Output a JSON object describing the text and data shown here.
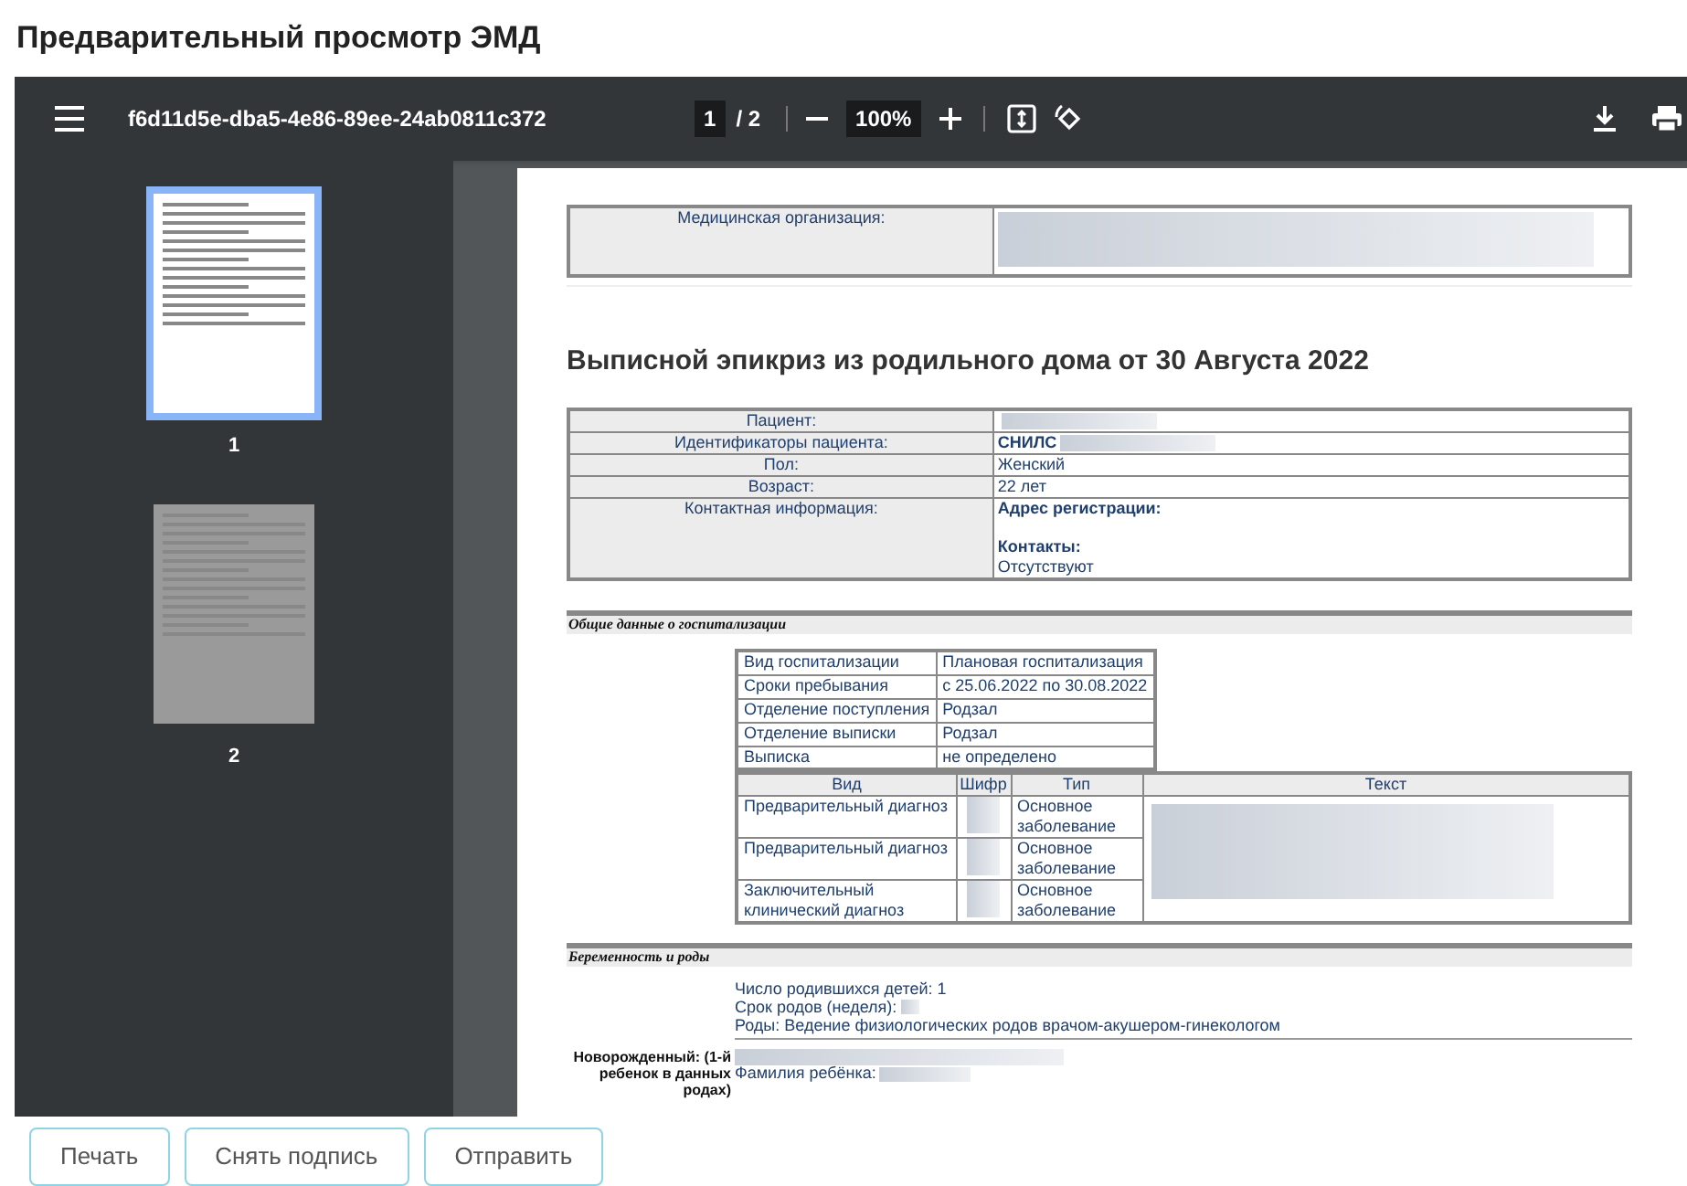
{
  "page_title": "Предварительный просмотр ЭМД",
  "viewer": {
    "file_name": "f6d11d5e-dba5-4e86-89ee-24ab0811c372",
    "page_current": "1",
    "page_total": "/ 2",
    "zoom": "100%"
  },
  "thumbnails": [
    {
      "label": "1",
      "selected": true
    },
    {
      "label": "2",
      "selected": false
    }
  ],
  "document": {
    "org_label": "Медицинская организация:",
    "title": "Выписной эпикриз из родильного дома от 30 Августа 2022",
    "patient_rows": [
      {
        "label": "Пациент:",
        "lines": [
          {
            "kind": "redacted"
          }
        ]
      },
      {
        "label": "Идентификаторы пациента:",
        "lines": [
          {
            "kind": "heading",
            "text": "СНИЛС"
          },
          {
            "kind": "redacted"
          }
        ]
      },
      {
        "label": "Пол:",
        "lines": [
          {
            "kind": "text",
            "text": "Женский"
          }
        ]
      },
      {
        "label": "Возраст:",
        "lines": [
          {
            "kind": "text",
            "text": "22 лет"
          }
        ]
      },
      {
        "label": "Контактная информация:",
        "lines": [
          {
            "kind": "heading",
            "text": "Адрес регистрации:"
          },
          {
            "kind": "gap"
          },
          {
            "kind": "heading",
            "text": "Контакты:"
          },
          {
            "kind": "text",
            "text": "Отсутствуют"
          }
        ]
      }
    ],
    "section_1": "Общие данные о госпитализации",
    "hosp_rows": [
      {
        "label": "Вид госпитализации",
        "value": "Плановая госпитализация"
      },
      {
        "label": "Сроки пребывания",
        "value": "с 25.06.2022 по 30.08.2022"
      },
      {
        "label": "Отделение поступления",
        "value": "Родзал"
      },
      {
        "label": "Отделение выписки",
        "value": "Родзал"
      },
      {
        "label": "Выписка",
        "value": "не определено"
      }
    ],
    "diag_columns": [
      "Вид",
      "Шифр",
      "Тип",
      "Текст"
    ],
    "diag_rows": [
      {
        "kind": "Предварительный диагноз",
        "type": "Основное заболевание"
      },
      {
        "kind": "Предварительный диагноз",
        "type": "Основное заболевание"
      },
      {
        "kind": "Заключительный клинический диагноз",
        "type": "Основное заболевание"
      }
    ],
    "section_2": "Беременность и роды",
    "birth_lines": [
      "Число родившихся детей: 1",
      "Срок родов (неделя):",
      "Роды: Ведение физиологических родов врачом-акушером-гинекологом"
    ],
    "newborn_label": "Новорожденный: (1-й ребенок в данных родах)",
    "newborn_field": "Фамилия ребёнка:"
  },
  "buttons": [
    "Печать",
    "Снять подпись",
    "Отправить"
  ]
}
